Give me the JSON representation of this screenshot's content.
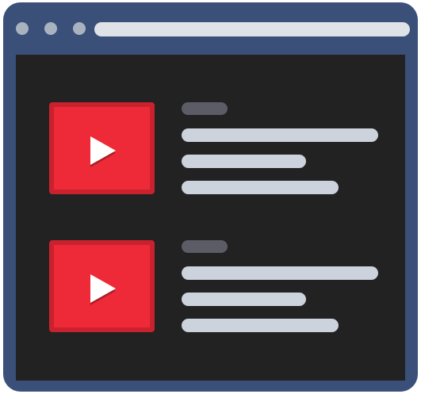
{
  "colors": {
    "frame": "#3a5079",
    "dot": "#a9b3c0",
    "urlbar": "#dfe3e8",
    "screen": "#222222",
    "thumb": "#ee2a38",
    "thumbBorder": "#c9222e",
    "tag": "#5c5c66",
    "line": "#ccd3dc"
  },
  "icons": {
    "window_controls": [
      "dot-icon",
      "dot-icon",
      "dot-icon"
    ],
    "video_item": "play-icon"
  },
  "video_items": [
    {
      "thumbnail_icon": "play-icon"
    },
    {
      "thumbnail_icon": "play-icon"
    }
  ]
}
